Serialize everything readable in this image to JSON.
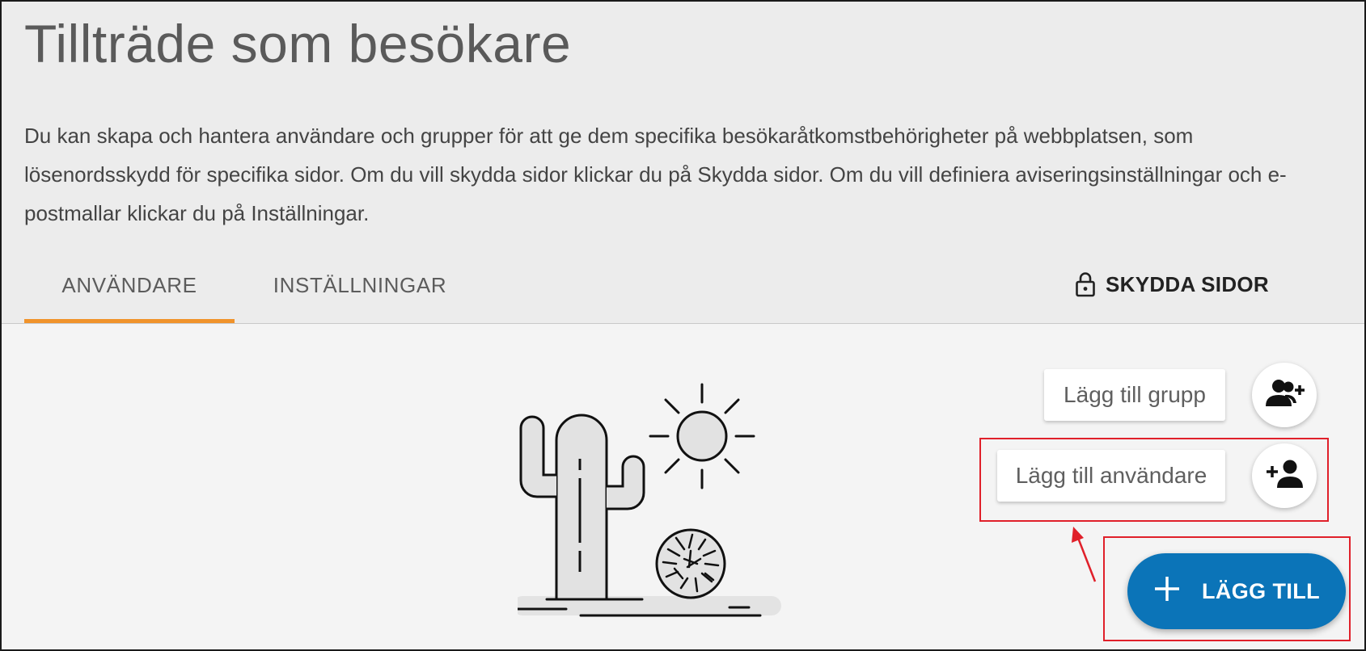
{
  "page": {
    "title": "Tillträde som besökare",
    "description": "Du kan skapa och hantera användare och grupper för att ge dem specifika besökaråtkomstbehörigheter på webbplatsen, som lösenordsskydd för specifika sidor. Om du vill skydda sidor klickar du på Skydda sidor. Om du vill definiera aviseringsinställningar och e-postmallar klickar du på Inställningar."
  },
  "tabs": {
    "users": "ANVÄNDARE",
    "settings": "INSTÄLLNINGAR",
    "active": "ANVÄNDARE"
  },
  "toolbar": {
    "protect_pages": "SKYDDA SIDOR",
    "protect_icon": "lock-icon"
  },
  "speed_dial": {
    "add_group_label": "Lägg till grupp",
    "add_group_icon": "group-add-icon",
    "add_user_label": "Lägg till användare",
    "add_user_icon": "person-add-icon",
    "main_label": "LÄGG TILL",
    "main_icon": "plus-icon"
  },
  "empty_state": {
    "illustration": "desert-cactus-sun-tumbleweed"
  },
  "colors": {
    "accent_orange": "#f0932b",
    "primary_blue": "#0b74b8",
    "annotation_red": "#e0202a"
  }
}
